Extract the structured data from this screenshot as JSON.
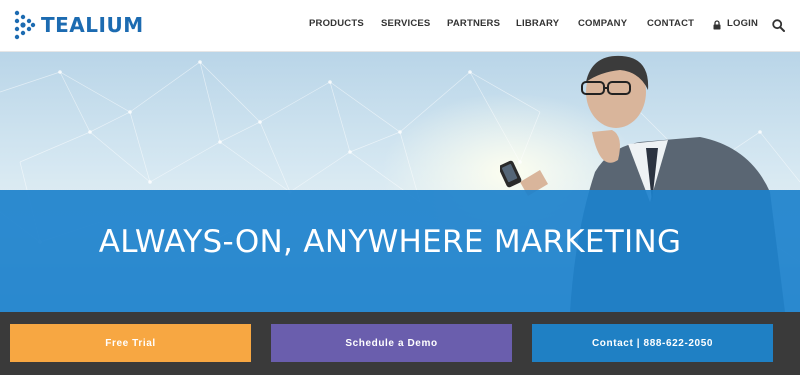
{
  "brand": {
    "name": "TEALIUM",
    "color": "#1c6bb1"
  },
  "nav": {
    "items": [
      {
        "label": "PRODUCTS"
      },
      {
        "label": "SERVICES"
      },
      {
        "label": "PARTNERS"
      },
      {
        "label": "LIBRARY"
      },
      {
        "label": "COMPANY"
      },
      {
        "label": "CONTACT"
      }
    ],
    "login": {
      "label": "LOGIN",
      "icon": "lock-icon"
    },
    "search": {
      "icon": "search-icon"
    }
  },
  "hero": {
    "headline": "ALWAYS-ON, ANYWHERE MARKETING",
    "band_color": "#1c81cc"
  },
  "cta": {
    "free_trial": {
      "label": "Free Trial",
      "color": "#f7a742"
    },
    "schedule_demo": {
      "label": "Schedule a Demo",
      "color": "#6a5ead"
    },
    "contact": {
      "label": "Contact | 888-622-2050",
      "color": "#1f80c4"
    }
  }
}
